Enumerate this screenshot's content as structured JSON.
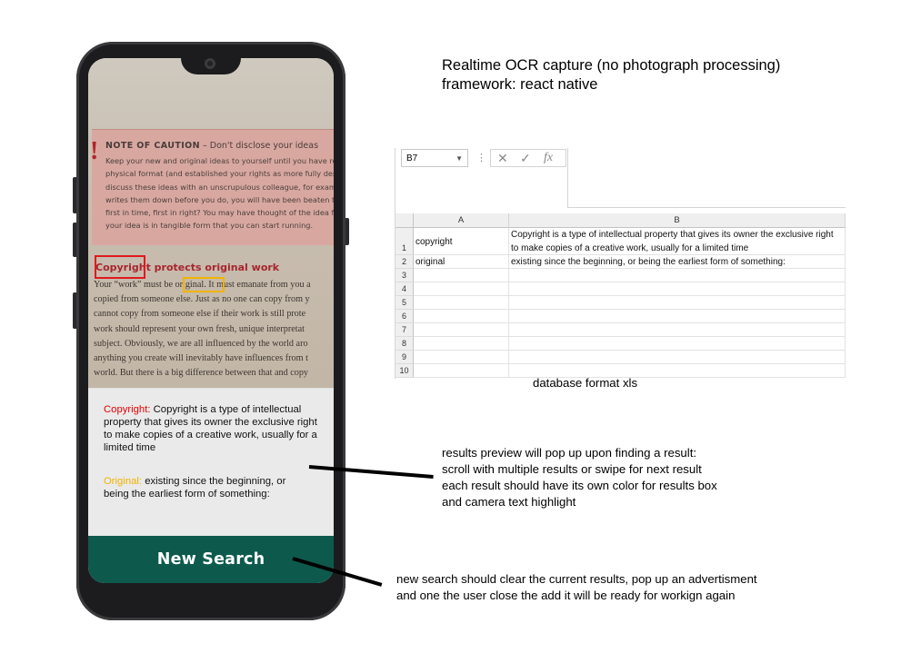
{
  "phone": {
    "book_page": {
      "caution_title": "NOTE OF CAUTION",
      "caution_title_rest": " – Don't disclose your ideas",
      "caution_lines": [
        "Keep your new and original ideas to yourself until you have rendered",
        "physical format (and established your rights as more fully described t",
        "discuss these ideas with an unscrupulous colleague, for example, an",
        "writes them down before you do, you will have been beaten to the p",
        "first in time, first in right? You may have thought of the idea first, but",
        "your idea is in tangible form that you can start running."
      ],
      "heading_word": "Copyright",
      "heading_rest": " protects original work",
      "body_line1_pre": "Your “work” must be ",
      "body_line1_word": "original.",
      "body_line1_post": " It must emanate from you a",
      "body_lines": [
        "copied from someone else. Just as no one can copy from y",
        "cannot copy from someone else if their work is still prote",
        "work should represent your own fresh, unique interpretat",
        "subject. Obviously, we are all influenced by the world aro",
        "anything you create will inevitably have influences from t",
        "world. But there is a big difference between that and copy"
      ]
    },
    "results": [
      {
        "key": "Copyright:",
        "text": " Copyright is a type of intellectual property that gives its owner the exclusive right to make copies of a creative work, usually for a limited time",
        "color": "#e40000"
      },
      {
        "key": "Original:",
        "text": " existing since the beginning, or being the earliest form of something:",
        "color": "#f2b200"
      }
    ],
    "new_search_label": "New Search",
    "button_color": "#0d5a4d"
  },
  "annotations": {
    "title_line1": "Realtime OCR capture (no photograph processing)",
    "title_line2": "framework: react native",
    "results_note": [
      "results preview will pop up upon finding a result:",
      "scroll with multiple results or swipe for next result",
      "each result should have its own color for results box",
      "and camera text highlight"
    ],
    "new_search_note": [
      "new search should clear the current results, pop up an advertisment",
      "and one the user close the add it will be ready for workign again"
    ],
    "xls_caption": "database format xls"
  },
  "spreadsheet": {
    "name_box": "B7",
    "cancel_icon": "✕",
    "enter_icon": "✓",
    "fx_label": "fx",
    "columns": [
      "A",
      "B"
    ],
    "row_numbers": [
      "1",
      "2",
      "3",
      "4",
      "5",
      "6",
      "7",
      "8",
      "9",
      "10"
    ],
    "rows": [
      {
        "a": "copyright",
        "b": "Copyright is a type of intellectual property that gives its owner the exclusive right to make copies of a creative work, usually for a limited time"
      },
      {
        "a": "original",
        "b": "existing since the beginning, or being the earliest form of something:"
      }
    ]
  }
}
